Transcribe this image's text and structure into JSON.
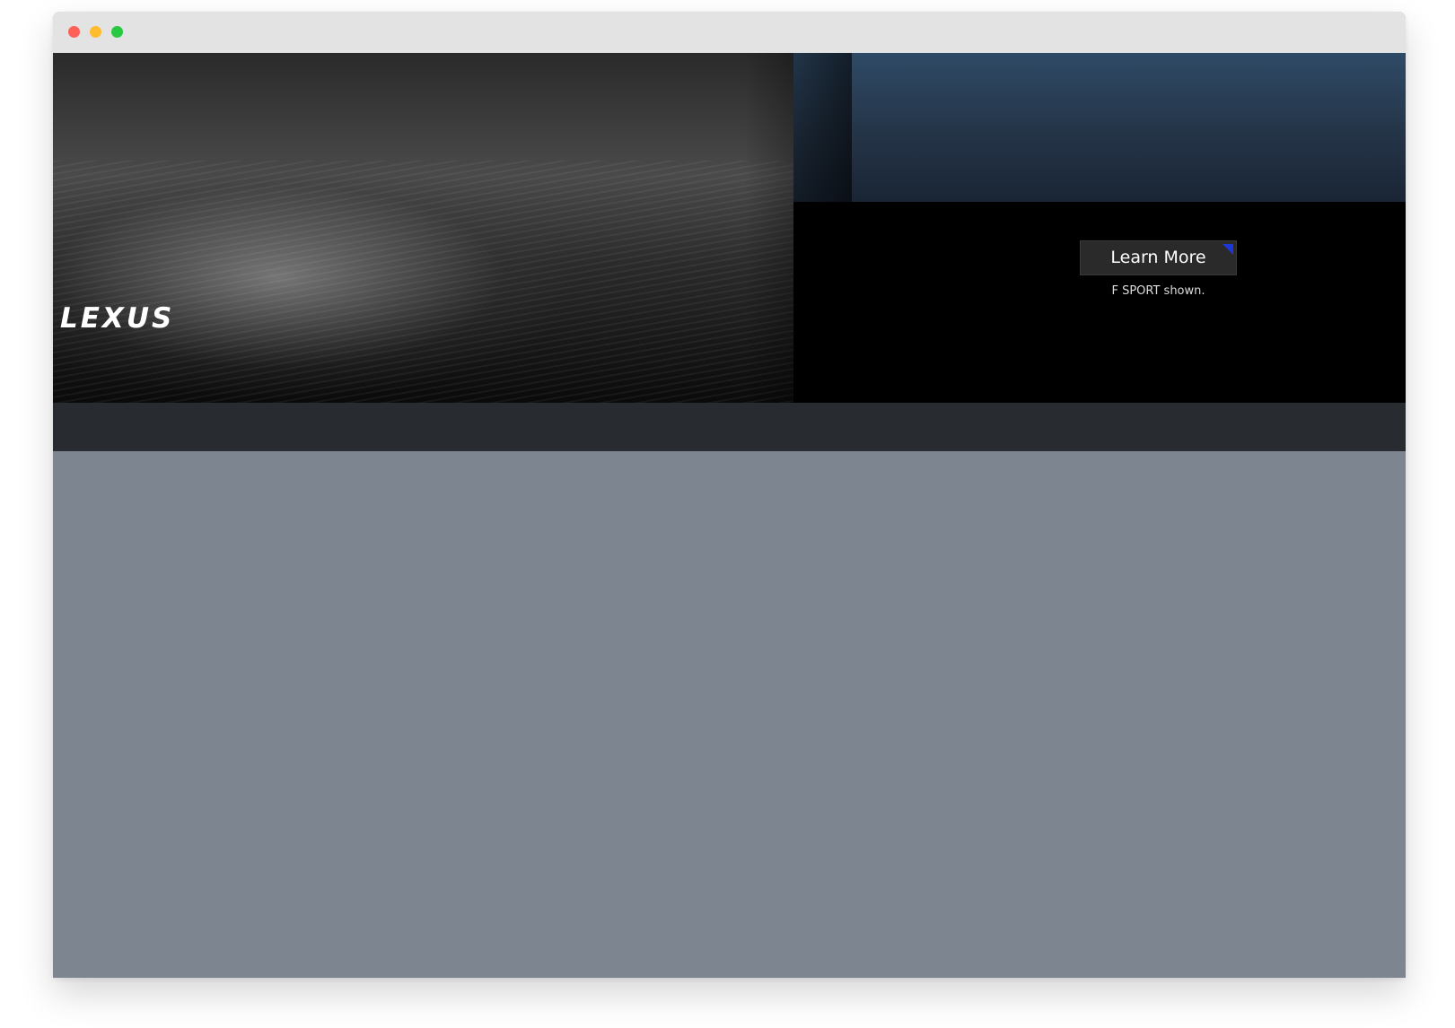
{
  "window": {
    "controls": [
      "close",
      "minimize",
      "maximize"
    ]
  },
  "banner": {
    "logo_text": "LEXUS",
    "cta_label": "Learn More",
    "caption": "F SPORT shown."
  },
  "colors": {
    "nav_bar": "#282b30",
    "content_background": "#7d8590",
    "cta_accent": "#1e37d9"
  }
}
